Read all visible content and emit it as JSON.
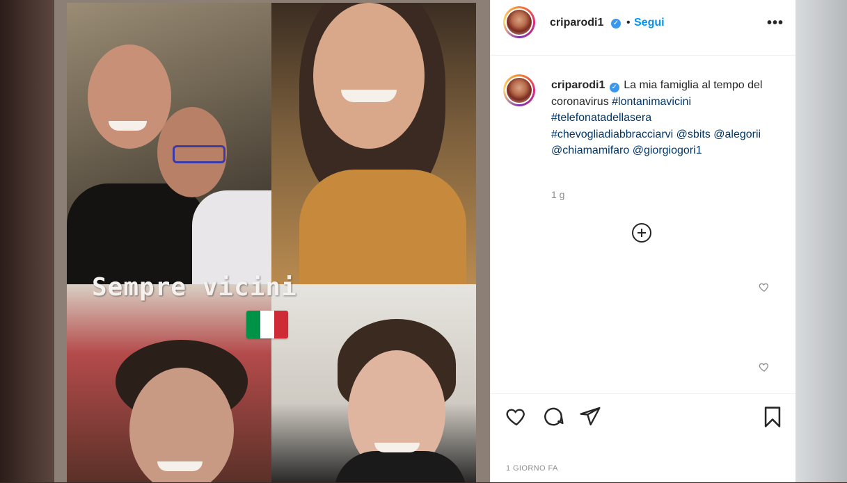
{
  "post": {
    "overlay_text": "Sempre vicini",
    "flag_colors": [
      "#009246",
      "#ffffff",
      "#ce2b37"
    ]
  },
  "header": {
    "username": "criparodi1",
    "separator": "•",
    "follow_label": "Segui",
    "more_icon": "more-horizontal-icon",
    "more_label": "•••"
  },
  "caption": {
    "username": "criparodi1",
    "text_before": "La mia famiglia al tempo del coronavirus",
    "hashtags": [
      "#lontanimavicini",
      "#telefonatadellasera",
      "#chevogliadiabbracciarvi"
    ],
    "mentions": [
      "@sbits",
      "@alegorii",
      "@chiamamifaro",
      "@giorgiogori1"
    ],
    "age": "1 g"
  },
  "actions": {
    "like_icon": "heart-icon",
    "comment_icon": "comment-icon",
    "share_icon": "send-icon",
    "save_icon": "bookmark-icon",
    "load_more_icon": "plus-circle-icon"
  },
  "footer": {
    "date": "1 GIORNO FA"
  },
  "colors": {
    "link": "#00376b",
    "follow": "#0095f6",
    "verified": "#3897f0"
  }
}
